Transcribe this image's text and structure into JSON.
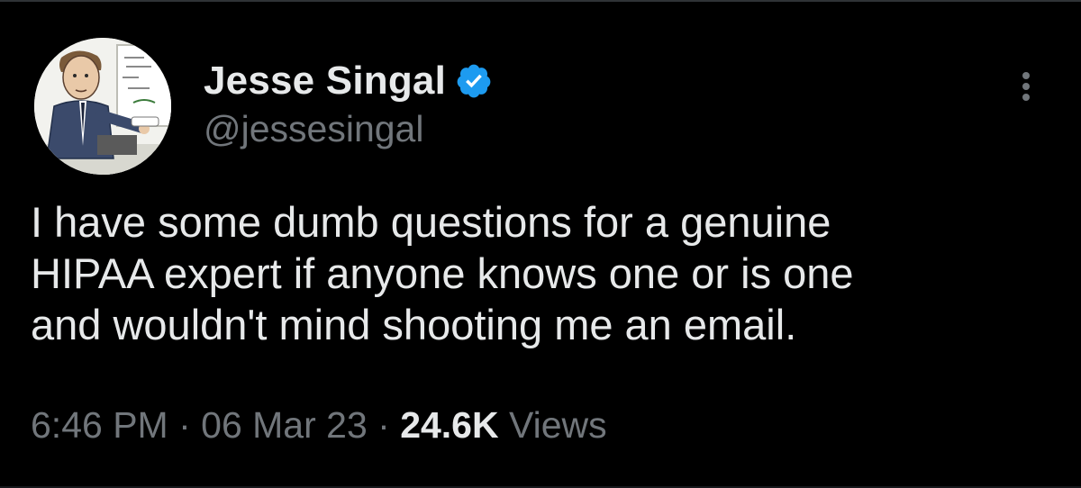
{
  "user": {
    "display_name": "Jesse Singal",
    "handle": "@jessesingal",
    "verified": true,
    "avatar_description": "cartoon-avatar"
  },
  "tweet": {
    "text": "I have some dumb questions for a genuine\nHIPAA expert if anyone knows one or is one\nand wouldn't mind shooting me an email.",
    "time": "6:46 PM",
    "date": "06 Mar 23",
    "separator": " · ",
    "views_count": "24.6K",
    "views_label": "Views"
  },
  "icons": {
    "verified": "verified-badge-icon",
    "more": "more-vertical-icon"
  },
  "colors": {
    "background": "#000000",
    "primary_text": "#e7e9ea",
    "secondary_text": "#71767b",
    "verified_blue": "#1d9bf0"
  }
}
